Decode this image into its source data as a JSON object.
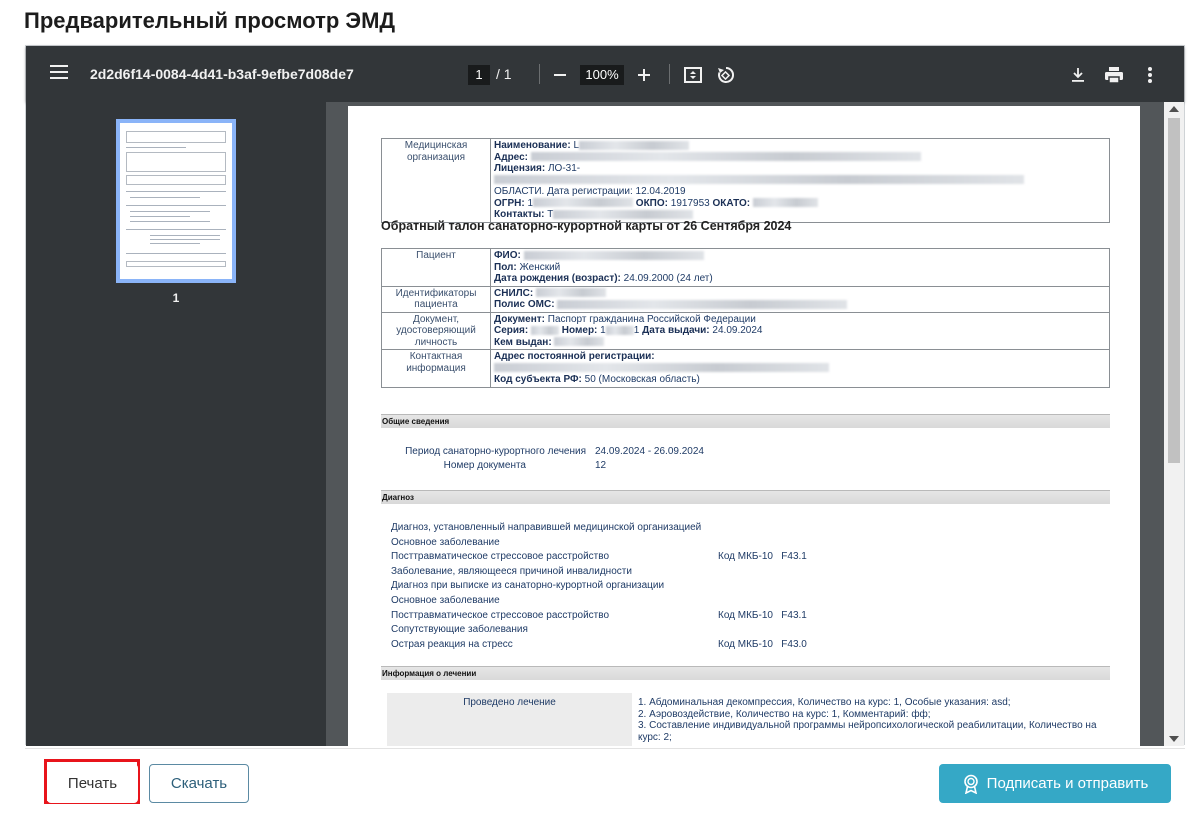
{
  "page": {
    "title": "Предварительный просмотр ЭМД"
  },
  "viewer": {
    "filename": "2d2d6f14-0084-4d41-b3af-9efbe7d08de7",
    "current_page": "1",
    "page_sep": "/ 1",
    "zoom": "100%",
    "thumbnail_label": "1",
    "icons": [
      "menu-icon",
      "zoom-out-icon",
      "zoom-in-icon",
      "fit-page-icon",
      "rotate-icon",
      "download-icon",
      "print-icon",
      "more-icon"
    ]
  },
  "document": {
    "org": {
      "label": "Медицинская организация",
      "name_key": "Наименование:",
      "name_val": "L",
      "address_key": "Адрес:",
      "license_key": "Лицензия:",
      "license_val": "ЛО-31-",
      "license_tail": "ОБЛАСТИ. Дата регистрации: 12.04.2019",
      "ogrn_key": "ОГРН:",
      "ogrn_val": "1",
      "okpo_key": "ОКПО:",
      "okpo_val": "1917953",
      "okato_key": "ОКАТО:",
      "contacts_key": "Контакты:",
      "contacts_val": "Т"
    },
    "heading": "Обратный талон санаторно-курортной карты от 26 Сентября 2024",
    "patient": {
      "label": "Пациент",
      "fio_key": "ФИО:",
      "sex_key": "Пол:",
      "sex_val": "Женский",
      "dob_key": "Дата рождения (возраст):",
      "dob_val": "24.09.2000 (24 лет)"
    },
    "ids": {
      "label": "Идентификаторы пациента",
      "snils_key": "СНИЛС:",
      "oms_key": "Полис ОМС:"
    },
    "identity": {
      "label": "Документ, удостоверяющий личность",
      "doc_key": "Документ:",
      "doc_val": "Паспорт гражданина Российской Федерации",
      "series_key": "Серия:",
      "number_key": "Номер:",
      "number_val": "1",
      "number_tail": "1",
      "issued_date_key": "Дата выдачи:",
      "issued_date_val": "24.09.2024",
      "issued_by_key": "Кем выдан:"
    },
    "contact": {
      "label": "Контактная информация",
      "address_key": "Адрес постоянной регистрации:",
      "region_key": "Код субъекта РФ:",
      "region_val": "50 (Московская область)"
    },
    "general": {
      "section": "Общие сведения",
      "period_label": "Период санаторно-курортного лечения",
      "period_val": "24.09.2024 - 26.09.2024",
      "docnum_label": "Номер документа",
      "docnum_val": "12"
    },
    "diagnosis": {
      "section": "Диагноз",
      "lines": [
        {
          "text": "Диагноз, установленный направившей медицинской организацией",
          "code": ""
        },
        {
          "text": "Основное заболевание",
          "code": ""
        },
        {
          "text": "Посттравматическое стрессовое расстройство",
          "code": "Код МКБ-10   F43.1"
        },
        {
          "text": "Заболевание, являющееся причиной инвалидности",
          "code": ""
        },
        {
          "text": "Диагноз при выписке из санаторно-курортной организации",
          "code": ""
        },
        {
          "text": "Основное заболевание",
          "code": ""
        },
        {
          "text": "Посттравматическое стрессовое расстройство",
          "code": "Код МКБ-10   F43.1"
        },
        {
          "text": "Сопутствующие заболевания",
          "code": ""
        },
        {
          "text": "Острая реакция на стресс",
          "code": "Код МКБ-10   F43.0"
        }
      ]
    },
    "treatment": {
      "section": "Информация о лечении",
      "label": "Проведено лечение",
      "lines": [
        "1. Абдоминальная декомпрессия, Количество на курс: 1, Особые указания: asd;",
        "2. Аэровоздействие, Количество на курс: 1, Комментарий: фф;",
        "3. Составление индивидуальной программы нейропсихологической реабилитации, Количество на курс: 2;"
      ]
    }
  },
  "actions": {
    "print": "Печать",
    "download": "Скачать",
    "sign_send": "Подписать и отправить"
  },
  "colors": {
    "accent": "#35a8c6",
    "highlight": "#e8141b",
    "toolbar": "#323639"
  }
}
